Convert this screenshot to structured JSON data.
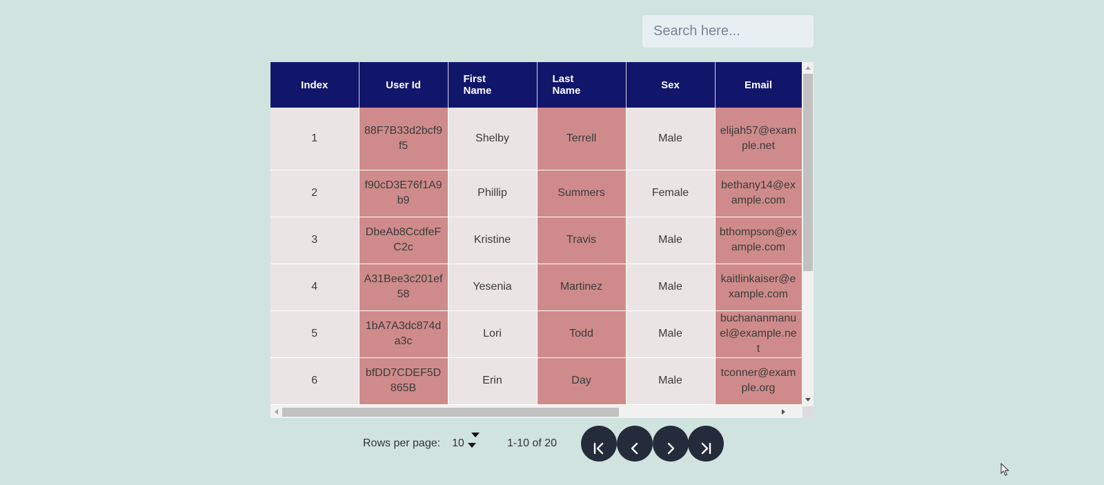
{
  "search": {
    "placeholder": "Search here...",
    "value": ""
  },
  "table": {
    "columns": [
      "Index",
      "User Id",
      "First Name",
      "Last Name",
      "Sex",
      "Email"
    ],
    "rows": [
      {
        "index": "1",
        "user_id": "88F7B33d2bcf9f5",
        "first_name": "Shelby",
        "last_name": "Terrell",
        "sex": "Male",
        "email": "elijah57@example.net"
      },
      {
        "index": "2",
        "user_id": "f90cD3E76f1A9b9",
        "first_name": "Phillip",
        "last_name": "Summers",
        "sex": "Female",
        "email": "bethany14@example.com"
      },
      {
        "index": "3",
        "user_id": "DbeAb8CcdfeFC2c",
        "first_name": "Kristine",
        "last_name": "Travis",
        "sex": "Male",
        "email": "bthompson@example.com"
      },
      {
        "index": "4",
        "user_id": "A31Bee3c201ef58",
        "first_name": "Yesenia",
        "last_name": "Martinez",
        "sex": "Male",
        "email": "kaitlinkaiser@example.com"
      },
      {
        "index": "5",
        "user_id": "1bA7A3dc874da3c",
        "first_name": "Lori",
        "last_name": "Todd",
        "sex": "Male",
        "email": "buchananmanuel@example.net"
      },
      {
        "index": "6",
        "user_id": "bfDD7CDEF5D865B",
        "first_name": "Erin",
        "last_name": "Day",
        "sex": "Male",
        "email": "tconner@example.org"
      }
    ]
  },
  "pagination": {
    "rows_per_page_label": "Rows per page:",
    "rows_per_page_value": "10",
    "range_text": "1-10 of 20",
    "buttons": [
      "first-page-icon",
      "previous-page-icon",
      "next-page-icon",
      "last-page-icon"
    ]
  },
  "colors": {
    "background": "#d1e3df",
    "header": "#12166b",
    "highlight_column": "#cf8b8b",
    "plain_column": "#ebe4e4",
    "page_button": "#242b3a"
  }
}
